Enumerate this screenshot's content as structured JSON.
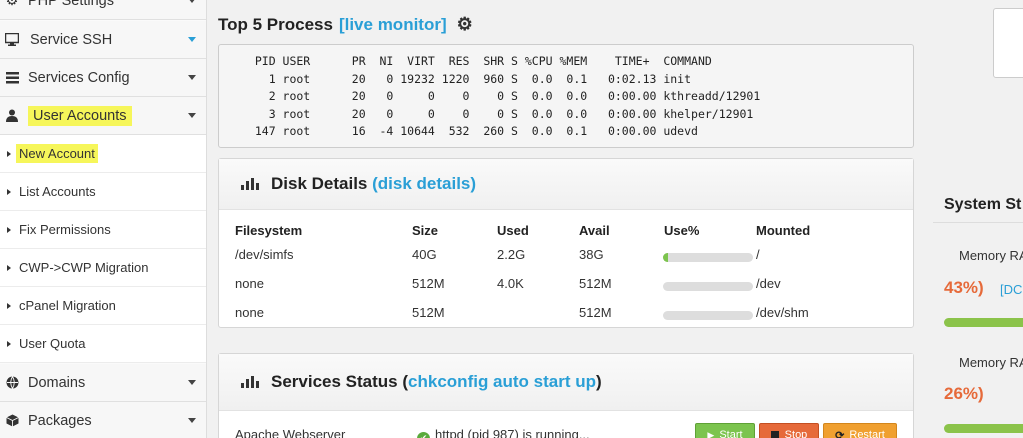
{
  "sidebar": {
    "php_settings": "PHP Settings",
    "service_ssh": "Service SSH",
    "services_config": "Services Config",
    "user_accounts": "User Accounts",
    "sub_items": [
      "New Account",
      "List Accounts",
      "Fix Permissions",
      "CWP->CWP Migration",
      "cPanel Migration",
      "User Quota"
    ],
    "domains": "Domains",
    "packages": "Packages"
  },
  "process": {
    "title": "Top 5 Process",
    "link": "[live monitor]",
    "lines": [
      "  PID USER      PR  NI  VIRT  RES  SHR S %CPU %MEM    TIME+  COMMAND",
      "    1 root      20   0 19232 1220  960 S  0.0  0.1   0:02.13 init",
      "    2 root      20   0     0    0    0 S  0.0  0.0   0:00.00 kthreadd/12901",
      "    3 root      20   0     0    0    0 S  0.0  0.0   0:00.00 khelper/12901",
      "  147 root      16  -4 10644  532  260 S  0.0  0.1   0:00.00 udevd"
    ]
  },
  "disk": {
    "title": "Disk Details",
    "link": "(disk details)",
    "headers": [
      "Filesystem",
      "Size",
      "Used",
      "Avail",
      "Use%",
      "Mounted"
    ],
    "rows": [
      {
        "fs": "/dev/simfs",
        "size": "40G",
        "used": "2.2G",
        "avail": "38G",
        "use_pct": 6,
        "mounted": "/"
      },
      {
        "fs": "none",
        "size": "512M",
        "used": "4.0K",
        "avail": "512M",
        "use_pct": 0,
        "mounted": "/dev"
      },
      {
        "fs": "none",
        "size": "512M",
        "used": "",
        "avail": "512M",
        "use_pct": 0,
        "mounted": "/dev/shm"
      }
    ]
  },
  "services": {
    "title": "Services Status",
    "link_open": "(",
    "link": "chkconfig auto start up",
    "link_close": ")",
    "row": {
      "name": "Apache Webserver",
      "status": "httpd (pid 987) is running...",
      "start": "Start",
      "stop": "Stop",
      "restart": "Restart"
    }
  },
  "system": {
    "title": "System St",
    "mem1_label": "Memory RA",
    "mem1_pct": "43%)",
    "mem1_link": "[DC",
    "mem2_label": "Memory RA",
    "mem2_pct": "26%)"
  },
  "colors": {
    "accent": "#2a9fd6",
    "highlight": "#f6f65a",
    "green": "#7cc44e",
    "orange": "#e66a3a"
  }
}
